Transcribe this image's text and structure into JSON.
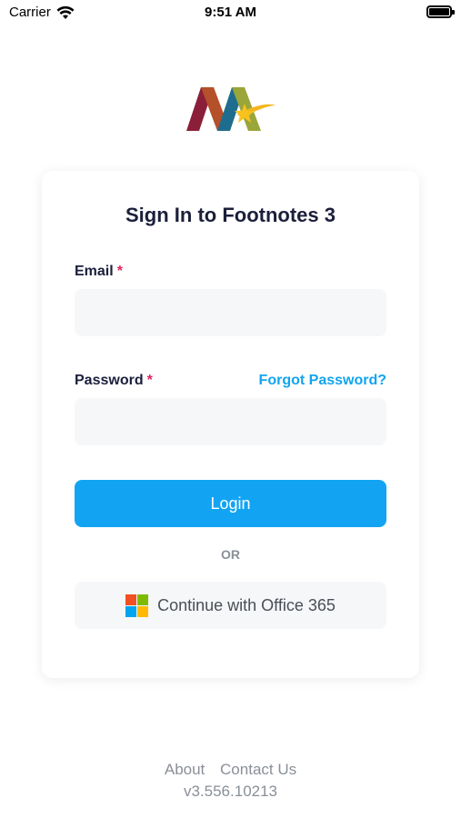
{
  "status_bar": {
    "carrier": "Carrier",
    "time": "9:51 AM"
  },
  "login": {
    "title": "Sign In to Footnotes 3",
    "email_label": "Email",
    "password_label": "Password",
    "required_mark": "*",
    "forgot_password": "Forgot Password?",
    "email_value": "",
    "password_value": "",
    "login_button": "Login",
    "or_text": "OR",
    "office_button": "Continue with Office 365"
  },
  "footer": {
    "about": "About",
    "contact": "Contact Us",
    "version": "v3.556.10213"
  },
  "colors": {
    "accent": "#12a4f3",
    "link": "#12a4ee",
    "required": "#e0245e",
    "input_bg": "#f5f7f9",
    "muted_text": "#8a8f98"
  },
  "icons": [
    "wifi-icon",
    "battery-icon",
    "app-logo",
    "microsoft-icon"
  ]
}
